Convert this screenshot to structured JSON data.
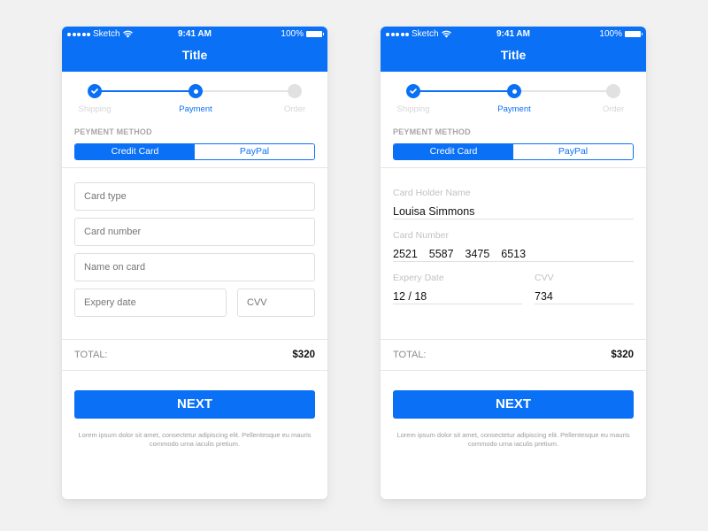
{
  "colors": {
    "accent": "#0a70f5",
    "background": "#f1f1f1",
    "inactive_step": "#e1e1e1"
  },
  "status_bar": {
    "carrier": "Sketch",
    "time": "9:41 AM",
    "battery": "100%"
  },
  "screens": [
    {
      "nav_title": "Title",
      "stepper": {
        "steps": [
          {
            "label": "Shipping",
            "state": "completed"
          },
          {
            "label": "Payment",
            "state": "current"
          },
          {
            "label": "Order",
            "state": "pending"
          }
        ]
      },
      "payment_method": {
        "label": "PEYMENT METHOD",
        "options": [
          "Credit Card",
          "PayPal"
        ],
        "selected": "Credit Card"
      },
      "form": {
        "card_type_placeholder": "Card type",
        "card_number_placeholder": "Card number",
        "name_on_card_placeholder": "Name on card",
        "expiry_placeholder": "Expery date",
        "cvv_placeholder": "CVV"
      },
      "total": {
        "label": "TOTAL:",
        "value": "$320"
      },
      "next_label": "NEXT",
      "footnote": "Lorem ipsum dolor sit amet, consectetur adipiscing elit. Pellentesque eu mauris commodo urna iaculis pretium."
    },
    {
      "nav_title": "Title",
      "stepper": {
        "steps": [
          {
            "label": "Shipping",
            "state": "completed"
          },
          {
            "label": "Payment",
            "state": "current"
          },
          {
            "label": "Order",
            "state": "pending"
          }
        ]
      },
      "payment_method": {
        "label": "PEYMENT METHOD",
        "options": [
          "Credit Card",
          "PayPal"
        ],
        "selected": "Credit Card"
      },
      "form": {
        "card_holder_label": "Card Holder Name",
        "card_holder_value": "Louisa Simmons",
        "card_number_label": "Card Number",
        "card_number_value": "2521  5587  3475  6513",
        "expiry_label": "Expery Date",
        "expiry_value": "12 / 18",
        "cvv_label": "CVV",
        "cvv_value": "734"
      },
      "total": {
        "label": "TOTAL:",
        "value": "$320"
      },
      "next_label": "NEXT",
      "footnote": "Lorem ipsum dolor sit amet, consectetur adipiscing elit. Pellentesque eu mauris commodo urna iaculis pretium."
    }
  ]
}
